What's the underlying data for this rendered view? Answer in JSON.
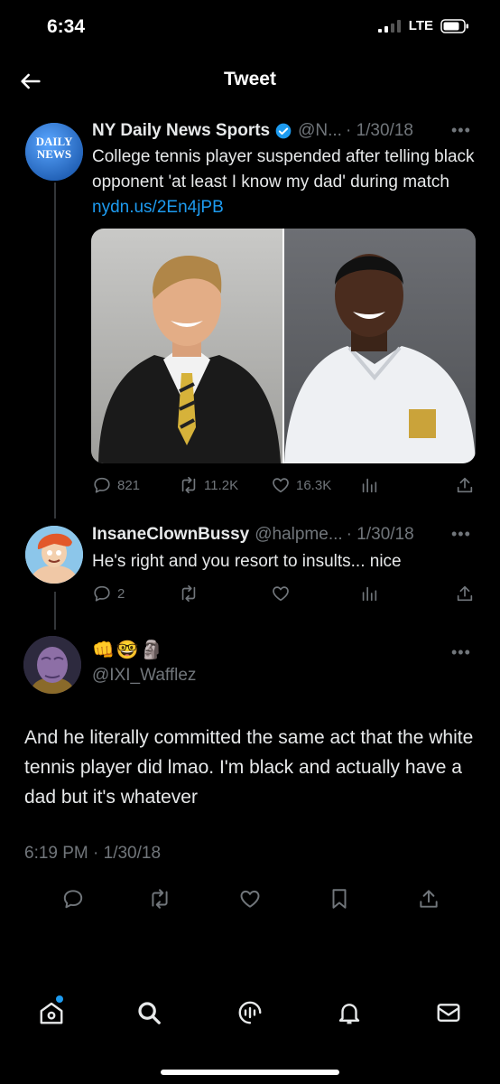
{
  "status_bar": {
    "time": "6:34",
    "network": "LTE"
  },
  "header": {
    "title": "Tweet"
  },
  "tweets": [
    {
      "name": "NY Daily News Sports",
      "handle": "@N...",
      "date": "· 1/30/18",
      "avatar_text_top": "DAILY",
      "avatar_text_bottom": "NEWS",
      "text": "College tennis player suspended after telling black opponent 'at least I know my dad' during match",
      "link": "nydn.us/2En4jPB",
      "replies": "821",
      "retweets": "11.2K",
      "likes": "16.3K"
    },
    {
      "name": "InsaneClownBussy",
      "handle": "@halpme...",
      "date": "· 1/30/18",
      "text": "He's right and you resort to insults... nice",
      "replies": "2"
    }
  ],
  "main_tweet": {
    "display_name_emojis": "👊🤓🗿",
    "handle": "@IXI_Wafflez",
    "text": "And he literally committed the same act that the white tennis player did lmao. I'm black and actually have a dad but it's whatever",
    "timestamp": "6:19 PM · 1/30/18"
  },
  "colors": {
    "background": "#000000",
    "accent": "#1d9bf0",
    "muted": "#71767b",
    "text": "#e7e9ea"
  }
}
